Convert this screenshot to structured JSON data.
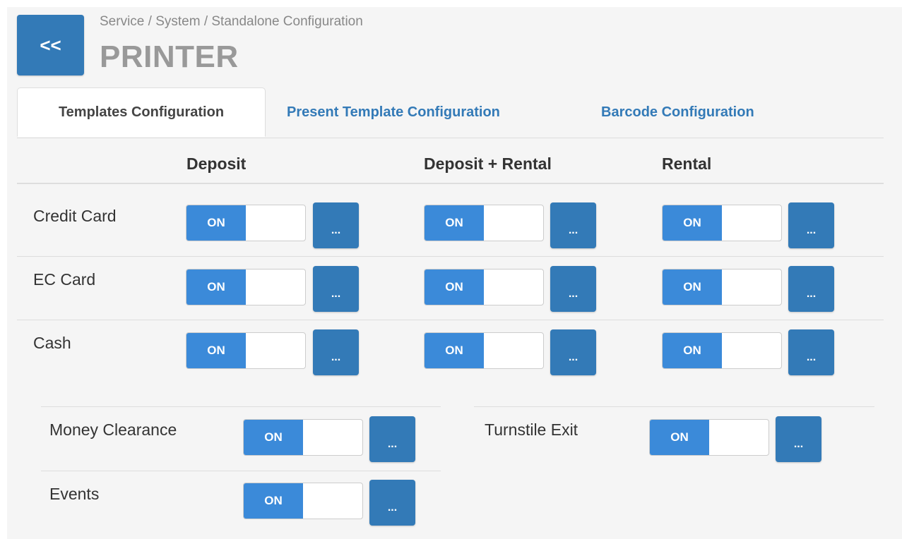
{
  "header": {
    "back_label": "<<",
    "breadcrumb": "Service / System / Standalone Configuration",
    "title": "PRINTER"
  },
  "tabs": [
    {
      "label": "Templates Configuration",
      "active": true
    },
    {
      "label": "Present Template Configuration",
      "active": false
    },
    {
      "label": "Barcode Configuration",
      "active": false
    }
  ],
  "columns": [
    "Deposit",
    "Deposit + Rental",
    "Rental"
  ],
  "rows": [
    {
      "label": "Credit Card",
      "toggles": [
        "ON",
        "ON",
        "ON"
      ]
    },
    {
      "label": "EC Card",
      "toggles": [
        "ON",
        "ON",
        "ON"
      ]
    },
    {
      "label": "Cash",
      "toggles": [
        "ON",
        "ON",
        "ON"
      ]
    }
  ],
  "extra": {
    "money_clearance": {
      "label": "Money Clearance",
      "toggle": "ON"
    },
    "events": {
      "label": "Events",
      "toggle": "ON"
    },
    "turnstile_exit": {
      "label": "Turnstile Exit",
      "toggle": "ON"
    }
  },
  "more_label": "...",
  "colors": {
    "primary": "#337ab7",
    "toggle_on": "#3b8ad9",
    "panel_bg": "#f5f5f5"
  }
}
